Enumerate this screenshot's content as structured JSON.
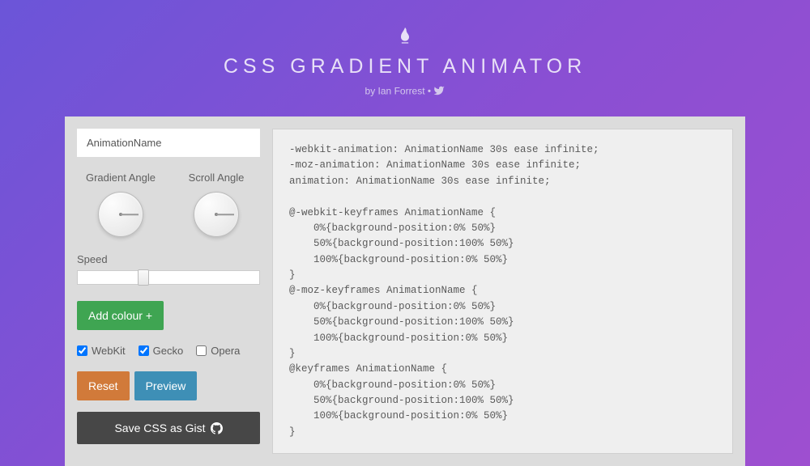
{
  "header": {
    "title": "CSS GRADIENT ANIMATOR",
    "byline_prefix": "by ",
    "author": "Ian Forrest",
    "separator": " • "
  },
  "controls": {
    "name_input_value": "AnimationName",
    "gradient_angle_label": "Gradient Angle",
    "scroll_angle_label": "Scroll Angle",
    "speed_label": "Speed",
    "add_colour_label": "Add colour +",
    "checks": {
      "webkit": {
        "label": "WebKit",
        "checked": true
      },
      "gecko": {
        "label": "Gecko",
        "checked": true
      },
      "opera": {
        "label": "Opera",
        "checked": false
      }
    },
    "reset_label": "Reset",
    "preview_label": "Preview",
    "save_gist_label": "Save CSS as Gist"
  },
  "code_output": "-webkit-animation: AnimationName 30s ease infinite;\n-moz-animation: AnimationName 30s ease infinite;\nanimation: AnimationName 30s ease infinite;\n\n@-webkit-keyframes AnimationName {\n    0%{background-position:0% 50%}\n    50%{background-position:100% 50%}\n    100%{background-position:0% 50%}\n}\n@-moz-keyframes AnimationName {\n    0%{background-position:0% 50%}\n    50%{background-position:100% 50%}\n    100%{background-position:0% 50%}\n}\n@keyframes AnimationName {\n    0%{background-position:0% 50%}\n    50%{background-position:100% 50%}\n    100%{background-position:0% 50%}\n}"
}
